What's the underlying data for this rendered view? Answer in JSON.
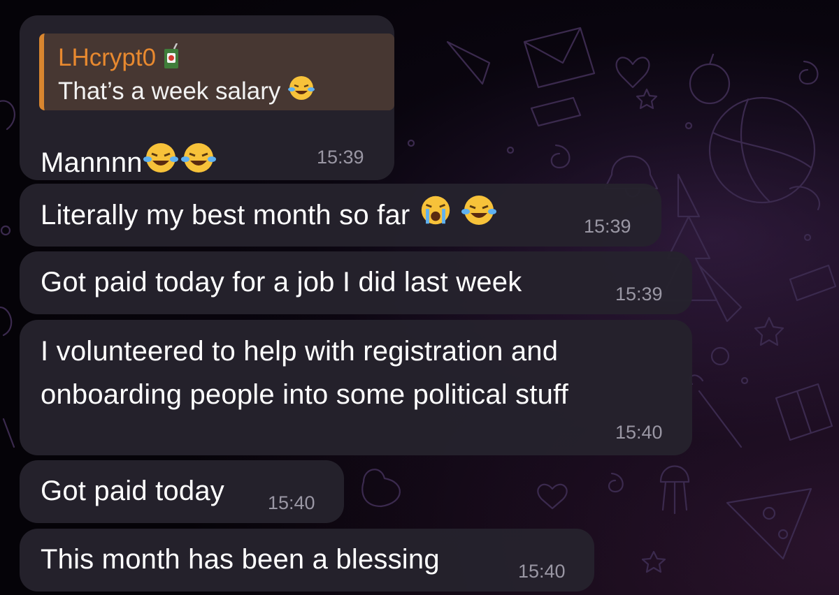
{
  "messages": [
    {
      "reply": {
        "author": "LHcrypt0",
        "author_icon": "juice-box-icon",
        "text": "That’s a week salary"
      },
      "text": "Mannnn",
      "emojis": [
        "laughing-tears-emoji",
        "laughing-tears-emoji"
      ],
      "time": "15:39"
    },
    {
      "text": "Literally my best month so far",
      "emojis": [
        "crying-emoji",
        "laughing-tears-emoji"
      ],
      "time": "15:39"
    },
    {
      "text": "Got paid today for a job I did last week",
      "time": "15:39"
    },
    {
      "line1": "I volunteered to help with registration and",
      "line2": "onboarding people into some political stuff",
      "time": "15:40"
    },
    {
      "text": "Got paid today",
      "time": "15:40"
    },
    {
      "text": "This month has been a blessing",
      "time": "15:40"
    }
  ],
  "colors": {
    "bubble": "#25222d",
    "reply_accent": "#d9862f",
    "reply_author": "#e8892f",
    "timestamp": "#9a97a4",
    "text": "#ffffff"
  }
}
